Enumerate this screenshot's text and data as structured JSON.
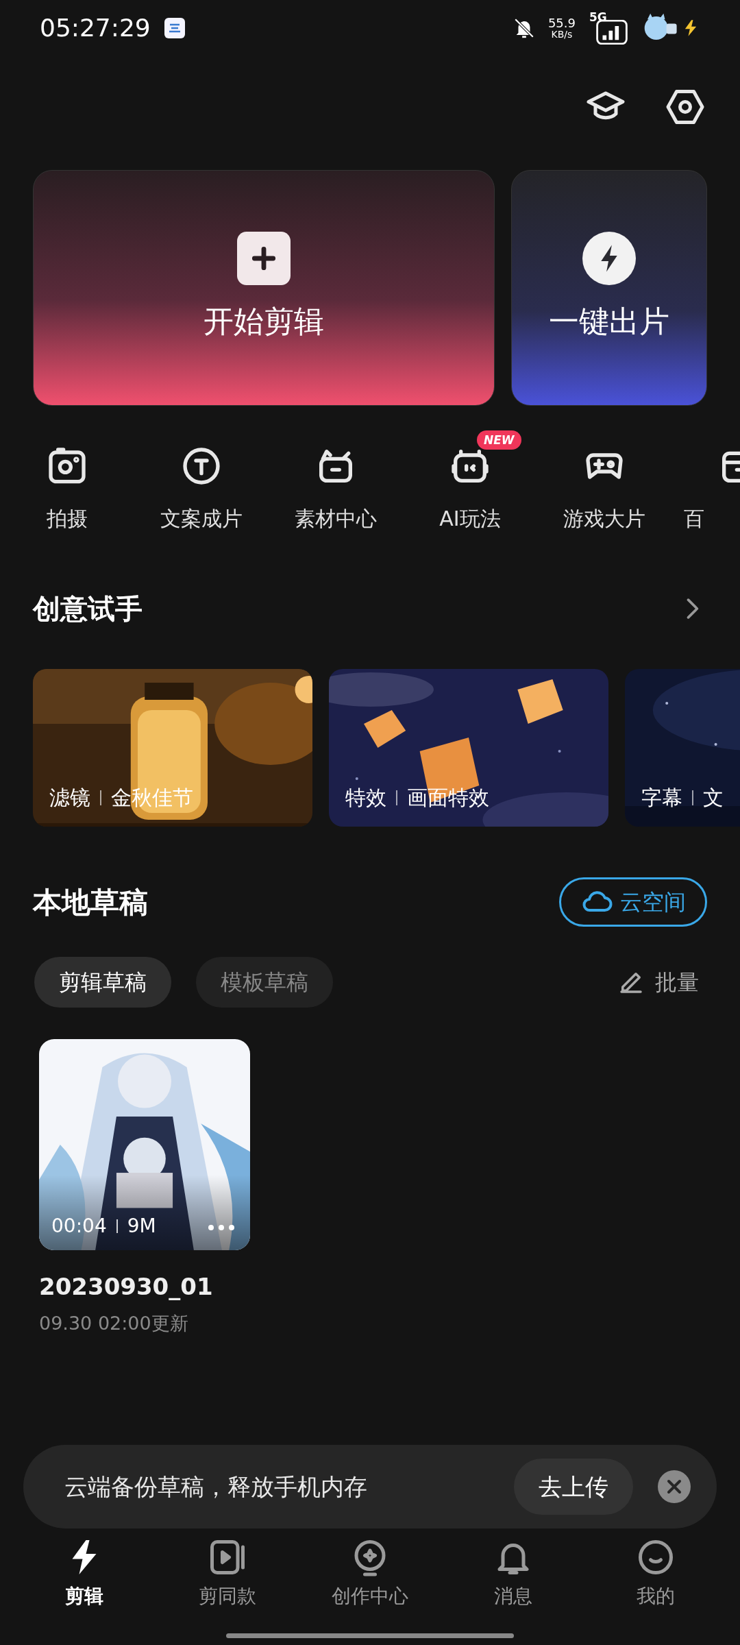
{
  "status_bar": {
    "time": "05:27:29",
    "speed_value": "55.9",
    "speed_unit": "KB/s",
    "network": "5G"
  },
  "hero": [
    {
      "kind": "start",
      "label": "开始剪辑"
    },
    {
      "kind": "quick",
      "label": "一键出片"
    }
  ],
  "tools": [
    {
      "kind": "camera",
      "label": "拍摄"
    },
    {
      "kind": "text",
      "label": "文案成片"
    },
    {
      "kind": "material",
      "label": "素材中心"
    },
    {
      "kind": "ai",
      "label": "AI玩法",
      "badge": "NEW"
    },
    {
      "kind": "game",
      "label": "游戏大片"
    },
    {
      "kind": "box",
      "label": "百"
    }
  ],
  "creative": {
    "title": "创意试手",
    "cards": [
      {
        "kind": "lantern",
        "category": "滤镜",
        "name": "金秋佳节"
      },
      {
        "kind": "sky",
        "category": "特效",
        "name": "画面特效"
      },
      {
        "kind": "night",
        "category": "字幕",
        "name": "文"
      }
    ]
  },
  "drafts": {
    "title": "本地草稿",
    "cloud_button": "云空间",
    "tabs": [
      {
        "label": "剪辑草稿",
        "selected": true
      },
      {
        "label": "模板草稿",
        "selected": false
      }
    ],
    "batch": "批量",
    "items": [
      {
        "duration": "00:04",
        "size": "9M",
        "name": "20230930_01",
        "updated": "09.30 02:00更新"
      }
    ]
  },
  "banner": {
    "text": "云端备份草稿，释放手机内存",
    "button": "去上传"
  },
  "nav": [
    {
      "kind": "edit",
      "label": "剪辑",
      "selected": true
    },
    {
      "kind": "template",
      "label": "剪同款",
      "selected": false
    },
    {
      "kind": "create",
      "label": "创作中心",
      "selected": false
    },
    {
      "kind": "bell",
      "label": "消息",
      "selected": false
    },
    {
      "kind": "me",
      "label": "我的",
      "selected": false
    }
  ]
}
